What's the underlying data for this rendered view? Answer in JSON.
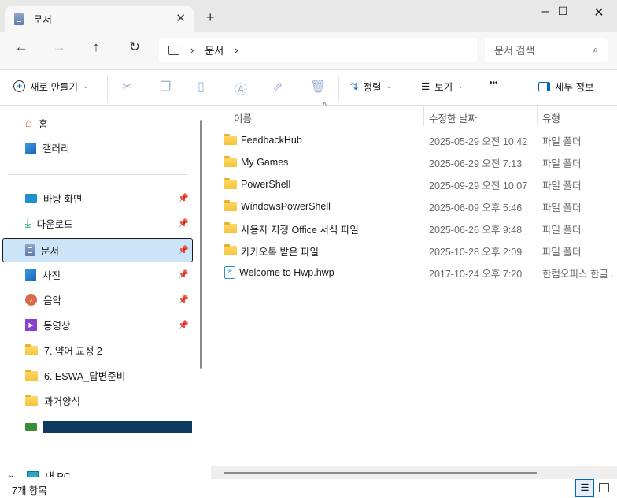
{
  "window": {
    "tab_title": "문서",
    "minimize": "—",
    "maximize": "☐",
    "close": "✕",
    "new_tab": "+"
  },
  "nav": {
    "back": "←",
    "forward": "→",
    "up": "↑",
    "refresh": "↻",
    "breadcrumb": [
      "문서"
    ],
    "search_placeholder": "문서 검색"
  },
  "toolbar": {
    "new_label": "새로 만들기",
    "sort_label": "정렬",
    "view_label": "보기",
    "more": "•••",
    "details_label": "세부 정보"
  },
  "sidebar": {
    "items": [
      {
        "label": "홈",
        "icon": "home-icon"
      },
      {
        "label": "갤러리",
        "icon": "gallery-icon"
      },
      {
        "label": "바탕 화면",
        "icon": "desktop-icon",
        "pinned": true
      },
      {
        "label": "다운로드",
        "icon": "download-icon",
        "pinned": true
      },
      {
        "label": "문서",
        "icon": "documents-icon",
        "pinned": true,
        "selected": true
      },
      {
        "label": "사진",
        "icon": "pictures-icon",
        "pinned": true
      },
      {
        "label": "음악",
        "icon": "music-icon",
        "pinned": true
      },
      {
        "label": "동영상",
        "icon": "videos-icon",
        "pinned": true
      },
      {
        "label": "7. 약어 교정 2",
        "icon": "folder-icon"
      },
      {
        "label": "6. ESWA_답변준비",
        "icon": "folder-icon"
      },
      {
        "label": "과거양식",
        "icon": "folder-icon"
      },
      {
        "label": "내 PC",
        "icon": "pc-icon"
      }
    ]
  },
  "columns": {
    "name": "이름",
    "date": "수정한 날짜",
    "type": "유형"
  },
  "files": [
    {
      "name": "FeedbackHub",
      "date": "2025-05-29 오전 10:42",
      "type": "파일 폴더"
    },
    {
      "name": "My Games",
      "date": "2025-06-29 오전 7:13",
      "type": "파일 폴더"
    },
    {
      "name": "PowerShell",
      "date": "2025-09-29 오전 10:07",
      "type": "파일 폴더"
    },
    {
      "name": "WindowsPowerShell",
      "date": "2025-06-09 오후 5:46",
      "type": "파일 폴더"
    },
    {
      "name": "사용자 지정 Office 서식 파일",
      "date": "2025-06-26 오후 9:48",
      "type": "파일 폴더"
    },
    {
      "name": "카카오톡 받은 파일",
      "date": "2025-10-28 오후 2:09",
      "type": "파일 폴더"
    },
    {
      "name": "Welcome to Hwp.hwp",
      "date": "2017-10-24 오후 7:20",
      "type": "한컴오피스 한글 ..."
    }
  ],
  "status": {
    "count": "7개 항목"
  },
  "colors": {
    "selected_bg": "#cce4f7",
    "accent": "#0067c0"
  }
}
